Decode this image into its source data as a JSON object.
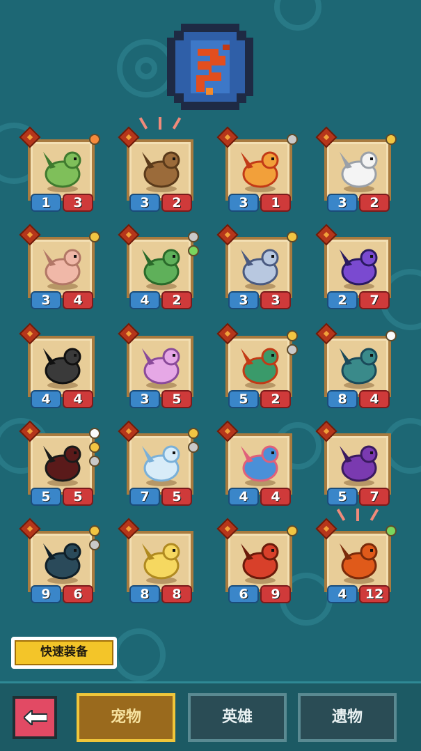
{
  "colors": {
    "background": "#1d6774",
    "card_fill": "#e8cd98",
    "card_border": "#a97b3f",
    "attack_badge": "#3a86c9",
    "health_badge": "#cf3a3a",
    "quick_equip": "#f3c529",
    "tab_selected": "#9a6a1d",
    "tab_unselected": "#2a4c55",
    "back_button": "#e24a64"
  },
  "header": {
    "emblem_icon": "dragon-emblem-icon"
  },
  "pets": [
    {
      "attack": "1",
      "health": "3",
      "creature": "green-dragonling",
      "badges": [
        "orange"
      ]
    },
    {
      "attack": "3",
      "health": "2",
      "creature": "brown-hedgehog",
      "badges": []
    },
    {
      "attack": "3",
      "health": "1",
      "creature": "fire-hatchling",
      "badges": [
        "skull"
      ]
    },
    {
      "attack": "3",
      "health": "2",
      "creature": "white-cat",
      "badges": [
        "gold"
      ]
    },
    {
      "attack": "3",
      "health": "4",
      "creature": "pink-puffball",
      "badges": [
        "gold"
      ]
    },
    {
      "attack": "4",
      "health": "2",
      "creature": "green-wyvern",
      "badges": [
        "skull",
        "green"
      ]
    },
    {
      "attack": "3",
      "health": "3",
      "creature": "silver-dragon",
      "badges": [
        "gold"
      ]
    },
    {
      "attack": "2",
      "health": "7",
      "creature": "void-dragon",
      "badges": []
    },
    {
      "attack": "4",
      "health": "4",
      "creature": "bone-dragon",
      "badges": []
    },
    {
      "attack": "3",
      "health": "5",
      "creature": "pink-fairy-dragon",
      "badges": []
    },
    {
      "attack": "5",
      "health": "2",
      "creature": "jade-serpent",
      "badges": [
        "gold",
        "skull"
      ]
    },
    {
      "attack": "8",
      "health": "4",
      "creature": "hydra",
      "badges": [
        "white"
      ]
    },
    {
      "attack": "5",
      "health": "5",
      "creature": "shadow-beast",
      "badges": [
        "white",
        "gold",
        "skull"
      ]
    },
    {
      "attack": "7",
      "health": "5",
      "creature": "ice-serpent",
      "badges": [
        "gold",
        "skull"
      ]
    },
    {
      "attack": "4",
      "health": "4",
      "creature": "blue-sea-serpent",
      "badges": []
    },
    {
      "attack": "5",
      "health": "7",
      "creature": "purple-dragon",
      "badges": []
    },
    {
      "attack": "9",
      "health": "6",
      "creature": "dark-serpent",
      "badges": [
        "gold",
        "skull"
      ]
    },
    {
      "attack": "8",
      "health": "8",
      "creature": "golden-dragon",
      "badges": []
    },
    {
      "attack": "6",
      "health": "9",
      "creature": "red-dragon",
      "badges": [
        "gold"
      ]
    },
    {
      "attack": "4",
      "health": "12",
      "creature": "lava-golem",
      "badges": [
        "green"
      ]
    }
  ],
  "quick_equip": {
    "label": "快速装备"
  },
  "bottom_nav": {
    "back_icon": "back-arrow-icon",
    "tabs": [
      {
        "label": "宠物",
        "selected": true
      },
      {
        "label": "英雄",
        "selected": false
      },
      {
        "label": "遗物",
        "selected": false
      }
    ]
  }
}
